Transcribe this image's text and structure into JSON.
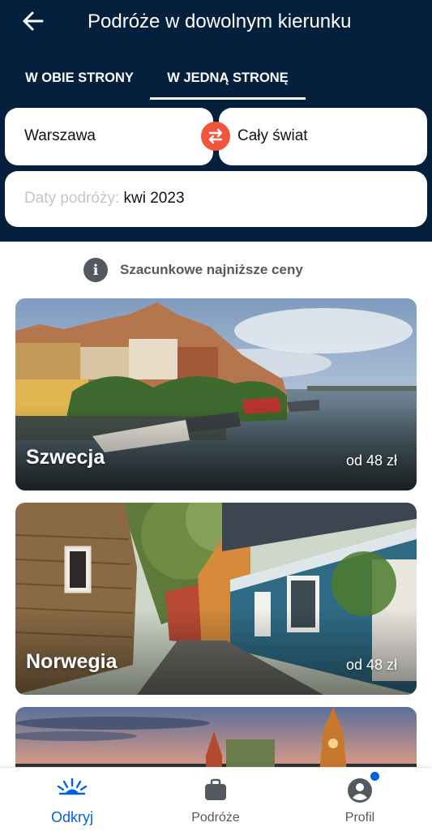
{
  "header": {
    "title": "Podróże w dowolnym kierunku",
    "back_icon": "arrow-left-icon",
    "tabs": [
      {
        "label": "W OBIE STRONY",
        "active": false
      },
      {
        "label": "W JEDNĄ STRONĘ",
        "active": true
      }
    ]
  },
  "search": {
    "from": "Warszawa",
    "to": "Cały świat",
    "swap_icon": "swap-arrows-icon",
    "dates_label": "Daty podróży:",
    "dates_value": "kwi 2023"
  },
  "info": {
    "icon": "info-icon",
    "text": "Szacunkowe najniższe ceny"
  },
  "destinations": [
    {
      "name": "Szwecja",
      "price": "od 48 zł"
    },
    {
      "name": "Norwegia",
      "price": "od 48 zł"
    },
    {
      "name": "",
      "price": ""
    }
  ],
  "bottom_nav": [
    {
      "label": "Odkryj",
      "icon": "sunrise-icon",
      "active": true
    },
    {
      "label": "Podróże",
      "icon": "suitcase-icon",
      "active": false
    },
    {
      "label": "Profil",
      "icon": "profile-icon",
      "active": false,
      "badge": true
    }
  ],
  "colors": {
    "header_bg": "#05203c",
    "accent_orange": "#f2543d",
    "active_blue": "#0062e3"
  }
}
